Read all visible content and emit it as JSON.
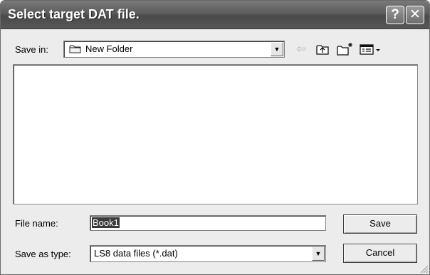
{
  "window": {
    "title": "Select target DAT file.",
    "help_glyph": "?",
    "close_glyph": "✕"
  },
  "toolbar": {
    "save_in_label": "Save in:",
    "save_in_value": "New Folder",
    "back_icon": "back-arrow-icon",
    "up_icon": "up-folder-icon",
    "new_folder_icon": "new-folder-icon",
    "views_icon": "views-menu-icon"
  },
  "file_list": {
    "items": []
  },
  "form": {
    "file_name_label": "File name:",
    "file_name_value": "Book1",
    "save_as_type_label": "Save as type:",
    "save_as_type_value": "LS8 data files (*.dat)"
  },
  "buttons": {
    "save": "Save",
    "cancel": "Cancel"
  },
  "colors": {
    "titlebar": "#5c5c5c",
    "dialog_bg": "#ececec",
    "list_bg": "#ffffff"
  }
}
